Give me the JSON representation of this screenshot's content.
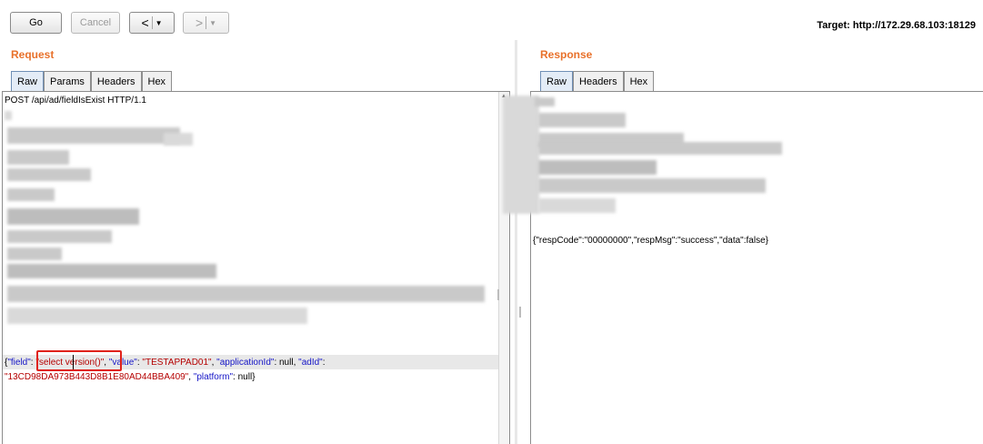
{
  "toolbar": {
    "go_label": "Go",
    "cancel_label": "Cancel",
    "back_glyph": "<",
    "forward_glyph": ">",
    "dropdown_glyph": "▼",
    "target_text": "Target: http://172.29.68.103:18129"
  },
  "request": {
    "title": "Request",
    "tabs": [
      "Raw",
      "Params",
      "Headers",
      "Hex"
    ],
    "active_tab": "Raw",
    "first_line": "POST /api/ad/fieldIsExist HTTP/1.1",
    "body": {
      "key_field": "\"field\"",
      "val_field": "\"select version()\"",
      "key_value": "\"value\"",
      "val_value": "\"TESTAPPAD01\"",
      "key_appid": "\"applicationId\"",
      "val_appid": "null",
      "key_adid": "\"adId\"",
      "val_adid": "\"13CD98DA973B443D8B1E80AD44BBA409\"",
      "key_platform": "\"platform\"",
      "val_platform": "null",
      "open_brace": "{",
      "close_brace": "}"
    }
  },
  "response": {
    "title": "Response",
    "tabs": [
      "Raw",
      "Headers",
      "Hex"
    ],
    "active_tab": "Raw",
    "body_line": "{\"respCode\":\"00000000\",\"respMsg\":\"success\",\"data\":false}"
  },
  "colors": {
    "accent": "#e8712b",
    "json_key": "#1515c7",
    "json_string": "#b50000",
    "highlight_box": "#e0221b"
  }
}
